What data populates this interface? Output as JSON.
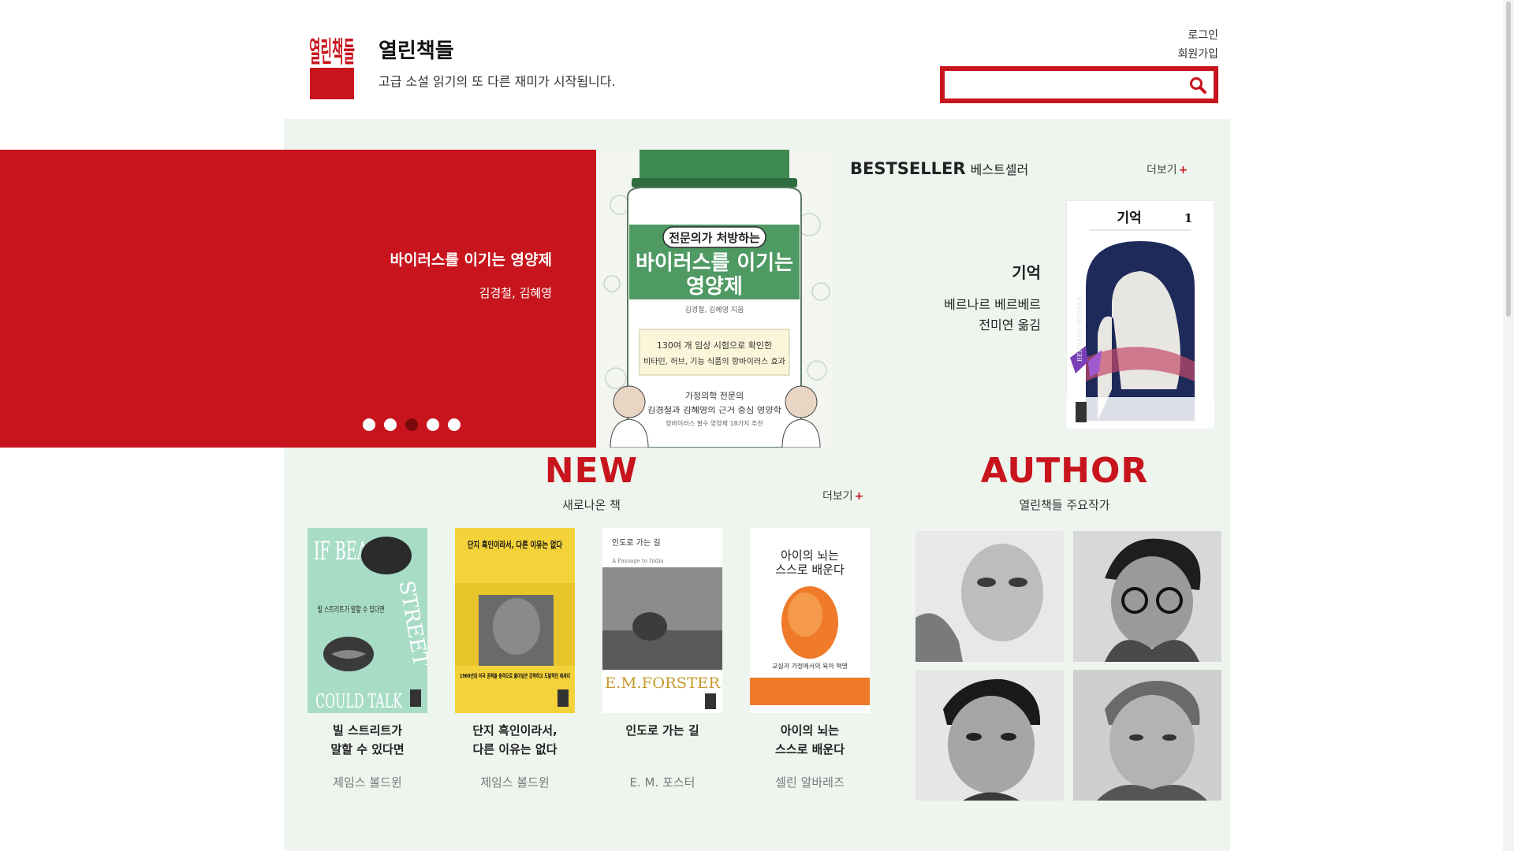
{
  "header": {
    "logo_text": "열린책들",
    "brand_name": "열린책들",
    "tagline": "고급 소설 읽기의 또 다른 재미가 시작됩니다.",
    "login": "로그인",
    "signup": "회원가입",
    "search_placeholder": "",
    "accent_color": "#c8151d"
  },
  "hero": {
    "title": "바이러스를 이기는 영양제",
    "author": "김경철, 김혜영",
    "dot_count": 5,
    "active_dot": 3,
    "cover": {
      "badge": "전문의가 처방하는",
      "title_line1": "바이러스를 이기는",
      "title_line2": "영양제",
      "authors": "김경철, 김혜영 지음",
      "box_line1": "130여 개 임상 시험으로 확인한",
      "box_line2": "비타민, 허브, 기능 식품의 항바이러스 효과",
      "bottom_line1": "가정의학 전문의",
      "bottom_line2": "김경철과 김혜영의 근거 중심 영양학",
      "bottom_line3": "항바이러스 필수 영양제 18가지 추천"
    }
  },
  "bestseller": {
    "heading": "BESTSELLER",
    "heading_ko": "베스트셀러",
    "more": "더보기",
    "plus": "+",
    "book_title": "기억",
    "author_line1": "베르나르 베르베르",
    "author_line2": "전미연 옮김",
    "cover_title": "기억",
    "cover_volume": "1",
    "cover_spine": "BERNARD WERBER"
  },
  "new_section": {
    "heading": "NEW",
    "sub": "새로나온 책",
    "more": "더보기",
    "plus": "+",
    "books": [
      {
        "title1": "빌 스트리트가",
        "title2": "말할 수 있다면",
        "author": "제임스 볼드윈",
        "cover_text1": "IF BEALE",
        "cover_text2": "STREET",
        "cover_text3": "COULD TALK",
        "cover_ko": "빌 스트리트가 말할 수 있다면"
      },
      {
        "title1": "단지 흑인이라서,",
        "title2": "다른 이유는 없다",
        "author": "제임스 볼드윈",
        "cover_ko": "단지 흑인이라서, 다른 이유는 없다",
        "cover_note": "1960년대 미국 권력을 충격으로 몰아넣은 강력하고 도발적인 에세이"
      },
      {
        "title1": "인도로 가는 길",
        "title2": "",
        "author": "E. M. 포스터",
        "cover_ko": "인도로 가는 길",
        "cover_en": "A Passage to India",
        "cover_name": "E.M.FORSTER"
      },
      {
        "title1": "아이의 뇌는",
        "title2": "스스로 배운다",
        "author": "셀린 알바레즈",
        "cover_ko1": "아이의 뇌는",
        "cover_ko2": "스스로 배운다",
        "cover_note": "교실과 가정에서의 육아 혁명"
      }
    ]
  },
  "author_section": {
    "heading": "AUTHOR",
    "sub": "열린책들 주요작가",
    "photos": [
      "author-1",
      "author-2",
      "author-3",
      "author-4"
    ]
  }
}
